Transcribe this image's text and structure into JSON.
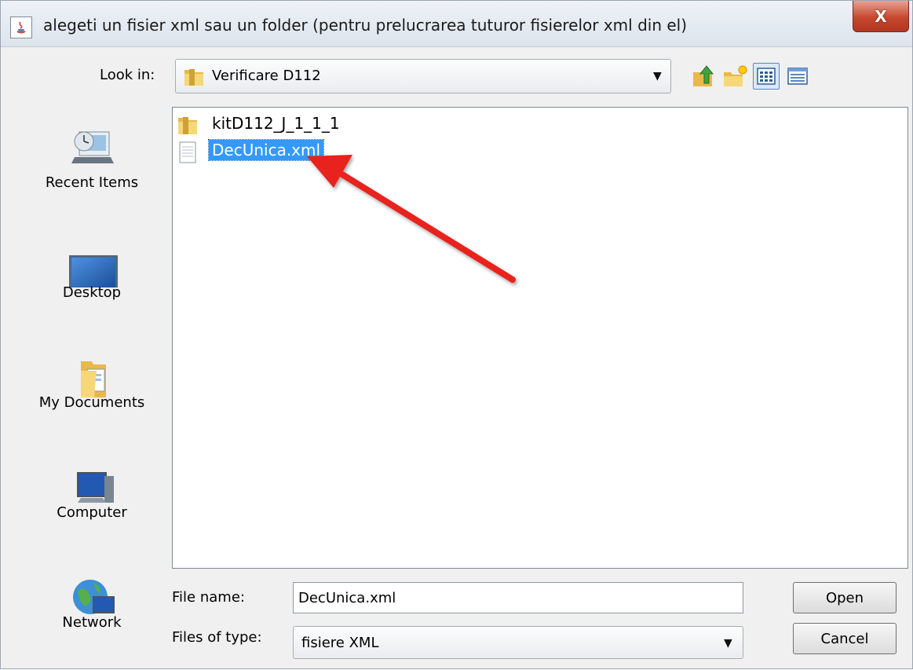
{
  "window": {
    "title": "alegeti un fisier xml sau un folder (pentru prelucrarea tuturor fisierelor xml din el)",
    "close_label": "X"
  },
  "lookin": {
    "label": "Look in:",
    "value": "Verificare D112"
  },
  "toolbar": {
    "icons": [
      "up-folder-icon",
      "new-folder-icon",
      "list-view-icon",
      "details-view-icon"
    ]
  },
  "places": [
    {
      "label": "Recent Items",
      "icon": "recent-items-icon"
    },
    {
      "label": "Desktop",
      "icon": "desktop-icon"
    },
    {
      "label": "My Documents",
      "icon": "my-documents-icon"
    },
    {
      "label": "Computer",
      "icon": "computer-icon"
    },
    {
      "label": "Network",
      "icon": "network-icon"
    }
  ],
  "files": [
    {
      "name": "kitD112_J_1_1_1",
      "type": "folder",
      "selected": false
    },
    {
      "name": "DecUnica.xml",
      "type": "file",
      "selected": true
    }
  ],
  "form": {
    "filename_label": "File name:",
    "filename_value": "DecUnica.xml",
    "filetype_label": "Files of type:",
    "filetype_value": "fisiere XML"
  },
  "buttons": {
    "open": "Open",
    "cancel": "Cancel"
  },
  "colors": {
    "selection": "#3399ff",
    "annotation_arrow": "#e8201c",
    "close_button": "#c7472e"
  }
}
